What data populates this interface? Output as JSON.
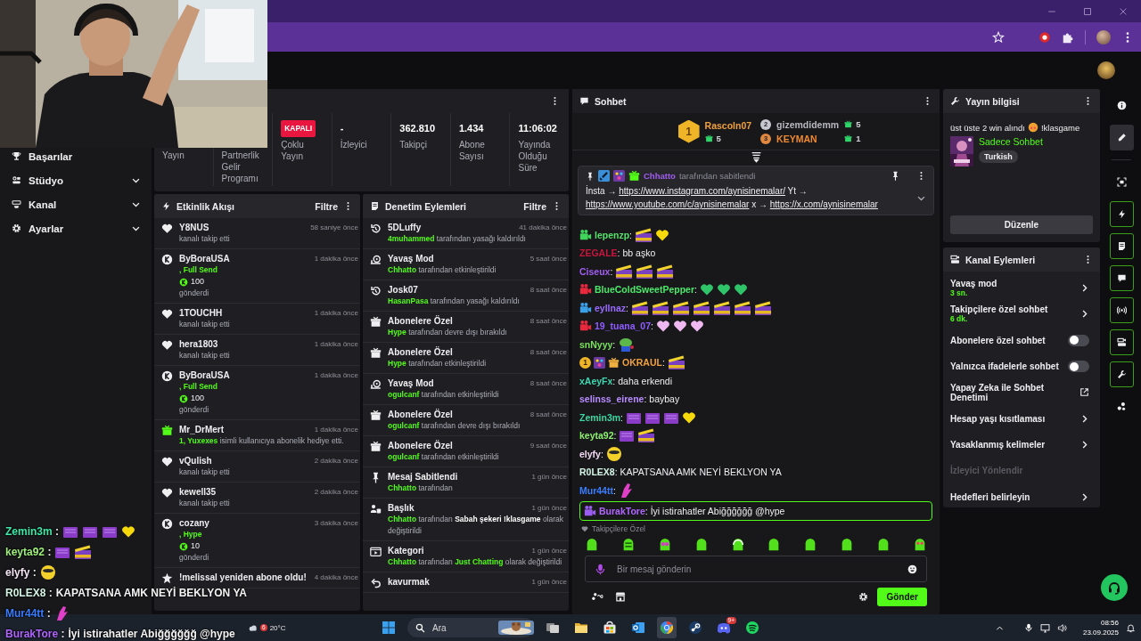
{
  "sidebar": {
    "items": [
      {
        "label": "Başarılar",
        "expandable": false
      },
      {
        "label": "Stüdyo",
        "expandable": true
      },
      {
        "label": "Kanal",
        "expandable": true
      },
      {
        "label": "Ayarlar",
        "expandable": true
      }
    ]
  },
  "stats": [
    {
      "kind": "label",
      "label": "Yayın"
    },
    {
      "kind": "label",
      "label": "Partnerlik Gelir Programı"
    },
    {
      "kind": "badge",
      "value": "KAPALI",
      "label": "Çoklu Yayın"
    },
    {
      "kind": "number",
      "value": "-",
      "label": "İzleyici"
    },
    {
      "kind": "number",
      "value": "362.810",
      "label": "Takipçi"
    },
    {
      "kind": "number",
      "value": "1.434",
      "label": "Abone Sayısı"
    },
    {
      "kind": "number",
      "value": "11:06:02",
      "label": "Yayında Olduğu Süre"
    }
  ],
  "activity_feed": {
    "title": "Etkinlik Akışı",
    "filter": "Filtre",
    "events": [
      {
        "kind": "follow",
        "user": "Y8NUS",
        "time": "58 saniye önce",
        "detail": "kanalı takip etti"
      },
      {
        "kind": "kicks",
        "user": "ByBoraUSA",
        "time": "1 dakika önce",
        "tier": ", Full Send",
        "amount": "100",
        "detail": "gönderdi"
      },
      {
        "kind": "follow",
        "user": "1TOUCHH",
        "time": "1 dakika önce",
        "detail": "kanalı takip etti"
      },
      {
        "kind": "follow",
        "user": "hera1803",
        "time": "1 dakika önce",
        "detail": "kanalı takip etti"
      },
      {
        "kind": "kicks",
        "user": "ByBoraUSA",
        "time": "1 dakika önce",
        "tier": ", Full Send",
        "amount": "100",
        "detail": "gönderdi"
      },
      {
        "kind": "gift",
        "user": "Mr_DrMert",
        "time": "1 dakika önce",
        "detail": "**1, Yuxexes** isimli kullanıcıya abonelik hediye etti."
      },
      {
        "kind": "follow",
        "user": "vQulish",
        "time": "2 dakika önce",
        "detail": "kanalı takip etti"
      },
      {
        "kind": "follow",
        "user": "kewell35",
        "time": "2 dakika önce",
        "detail": "kanalı takip etti"
      },
      {
        "kind": "kicks",
        "user": "cozany",
        "time": "3 dakika önce",
        "tier": ", Hype",
        "amount": "10",
        "detail": "gönderdi"
      },
      {
        "kind": "resub",
        "user": "!melissal yeniden abone oldu!",
        "time": "4 dakika önce"
      }
    ]
  },
  "mod_actions": {
    "title": "Denetim Eylemleri",
    "filter": "Filtre",
    "actions": [
      {
        "kind": "unban",
        "title": "5DLuffy",
        "time": "41 dakika önce",
        "detail": "**4muhammed** tarafından yasağı kaldırıldı"
      },
      {
        "kind": "slow",
        "title": "Yavaş Mod",
        "time": "5 saat önce",
        "detail": "**Chhatto** tarafından etkinleştirildi"
      },
      {
        "kind": "unban",
        "title": "Josk07",
        "time": "8 saat önce",
        "detail": "**HasanPasa** tarafından yasağı kaldırıldı"
      },
      {
        "kind": "subs",
        "title": "Abonelere Özel",
        "time": "8 saat önce",
        "detail": "**Hype** tarafından devre dışı bırakıldı"
      },
      {
        "kind": "subs",
        "title": "Abonelere Özel",
        "time": "8 saat önce",
        "detail": "**Hype** tarafından etkinleştirildi"
      },
      {
        "kind": "slow",
        "title": "Yavaş Mod",
        "time": "8 saat önce",
        "detail": "**ogulcanf** tarafından etkinleştirildi"
      },
      {
        "kind": "subs",
        "title": "Abonelere Özel",
        "time": "8 saat önce",
        "detail": "**ogulcanf** tarafından devre dışı bırakıldı"
      },
      {
        "kind": "subs",
        "title": "Abonelere Özel",
        "time": "9 saat önce",
        "detail": "**ogulcanf** tarafından etkinleştirildi"
      },
      {
        "kind": "pin",
        "title": "Mesaj Sabitlendi",
        "time": "1 gün önce",
        "detail": "**Chhatto** tarafından"
      },
      {
        "kind": "title",
        "title": "Başlık",
        "time": "1 gün önce",
        "detail": "**Chhatto** tarafından *Sabah şekeri !klasgame* olarak değiştirildi"
      },
      {
        "kind": "category",
        "title": "Kategori",
        "time": "1 gün önce",
        "detail": "**Chhatto** tarafından **Just Chatting** olarak değiştirildi"
      },
      {
        "kind": "undo",
        "title": "kavurmak",
        "time": "1 gün önce"
      }
    ]
  },
  "chat": {
    "title": "Sohbet",
    "separator": ":",
    "leaderboard": [
      {
        "rank": "1",
        "user": "Rascoln07",
        "gifts": "5"
      },
      {
        "rank": "2",
        "user": "gizemdidemm",
        "gifts": "5"
      },
      {
        "rank": "3",
        "user": "KEYMAN",
        "gifts": "1"
      }
    ],
    "pinned": {
      "badges": [
        {
          "kind": "mod"
        },
        {
          "kind": "artist"
        },
        {
          "kind": "gift",
          "color": "#53fc18"
        }
      ],
      "user": "Chhatto",
      "note": "tarafından sabitlendi",
      "content": [
        {
          "kind": "text",
          "text": "İnsta →"
        },
        {
          "kind": "link",
          "text": "https://www.instagram.com/aynisinemalar/"
        },
        {
          "kind": "text",
          "text": "Yt →"
        },
        {
          "kind": "link",
          "text": "https://www.youtube.com/c/aynisinemalar"
        },
        {
          "kind": "text",
          "text": "x →"
        },
        {
          "kind": "link",
          "text": "https://x.com/aynisinemalar"
        }
      ]
    },
    "messages": [
      {
        "user": "lepenzp",
        "color": "#57e06a",
        "highlighted": false,
        "badges": [
          {
            "kind": "camera",
            "color": "#3fd45a"
          }
        ],
        "emotes": [
          {
            "kind": "clapper"
          },
          {
            "kind": "heart",
            "color": "#f5d90a"
          }
        ]
      },
      {
        "user": "ZEGALE",
        "color": "#c8163c",
        "highlighted": false,
        "text": "bb aşko"
      },
      {
        "user": "Ciseux",
        "color": "#a25ef0",
        "highlighted": false,
        "emotes": [
          {
            "kind": "clapper"
          },
          {
            "kind": "clapper"
          },
          {
            "kind": "clapper"
          }
        ]
      },
      {
        "user": "BlueColdSweetPepper",
        "color": "#4ce86a",
        "highlighted": false,
        "badges": [
          {
            "kind": "camera",
            "color": "#e8283c"
          }
        ],
        "emotes": [
          {
            "kind": "heart",
            "color": "#2fc46a"
          },
          {
            "kind": "heart",
            "color": "#2fc46a"
          },
          {
            "kind": "heart",
            "color": "#2fc46a"
          }
        ]
      },
      {
        "user": "eyllnaz",
        "color": "#9a6bff",
        "highlighted": false,
        "badges": [
          {
            "kind": "camera",
            "color": "#3aa0e8"
          }
        ],
        "emotes": [
          {
            "kind": "clapper"
          },
          {
            "kind": "clapper"
          },
          {
            "kind": "clapper"
          },
          {
            "kind": "clapper"
          },
          {
            "kind": "clapper"
          },
          {
            "kind": "clapper"
          },
          {
            "kind": "clapper"
          }
        ]
      },
      {
        "user": "19_tuana_07",
        "color": "#8f5cff",
        "highlighted": false,
        "badges": [
          {
            "kind": "camera",
            "color": "#e8283c"
          }
        ],
        "emotes": [
          {
            "kind": "heart",
            "color": "#f0b8f0"
          },
          {
            "kind": "heart",
            "color": "#f0b8f0"
          },
          {
            "kind": "heart",
            "color": "#f0b8f0"
          }
        ]
      },
      {
        "user": "snNyyy",
        "color": "#78e05a",
        "highlighted": false,
        "emotes": [
          {
            "kind": "frog"
          }
        ]
      },
      {
        "user": "OKRAUL",
        "color": "#f0a040",
        "highlighted": false,
        "badges": [
          {
            "kind": "rank",
            "text": "1"
          },
          {
            "kind": "artist"
          },
          {
            "kind": "gift",
            "color": "#f0b040"
          }
        ],
        "emotes": [
          {
            "kind": "clapper"
          }
        ]
      },
      {
        "user": "xAeyFx",
        "color": "#3dd6b0",
        "highlighted": false,
        "text": "daha erkendi"
      },
      {
        "user": "selinss_eirene",
        "color": "#b98cff",
        "highlighted": false,
        "text": "baybay"
      },
      {
        "user": "Zemin3m",
        "color": "#3dd6a0",
        "highlighted": false,
        "emotes": [
          {
            "kind": "screen"
          },
          {
            "kind": "screen"
          },
          {
            "kind": "screen"
          },
          {
            "kind": "heart",
            "color": "#f5d90a"
          }
        ]
      },
      {
        "user": "keyta92",
        "color": "#8ef070",
        "highlighted": false,
        "emotes": [
          {
            "kind": "screen"
          },
          {
            "kind": "clapper"
          }
        ]
      },
      {
        "user": "elyfy",
        "color": "#f2d8f2",
        "highlighted": false,
        "emotes": [
          {
            "kind": "smiley"
          }
        ]
      },
      {
        "user": "R0LEX8",
        "color": "#d4f4e4",
        "highlighted": false,
        "text": "KAPATSANA AMK NEYİ BEKLYON YA"
      },
      {
        "user": "Mur44tt",
        "color": "#3b7dff",
        "highlighted": false,
        "emotes": [
          {
            "kind": "hand"
          }
        ]
      },
      {
        "user": "BurakTore",
        "color": "#b066ff",
        "highlighted": true,
        "badges": [
          {
            "kind": "camera",
            "color": "#9b5cf0"
          }
        ],
        "text": "İyi istirahatler Abiğğğğğğ @hype"
      }
    ],
    "emote_bar": {
      "label": "Takipçilere Özel",
      "emotes": [
        {
          "kind": "blob"
        },
        {
          "kind": "angry"
        },
        {
          "kind": "glasses"
        },
        {
          "kind": "blob"
        },
        {
          "kind": "headset"
        },
        {
          "kind": "blob"
        },
        {
          "kind": "blob"
        },
        {
          "kind": "blob"
        },
        {
          "kind": "blob"
        },
        {
          "kind": "hearts"
        }
      ]
    },
    "input": {
      "placeholder": "Bir mesaj gönderin"
    },
    "send": "Gönder"
  },
  "stream_info": {
    "heading": "Yayın bilgisi",
    "title_before": "üst üste 2 win alındı",
    "title_after": "!klasgame",
    "category": "Sadece Sohbet",
    "tag": "Turkish",
    "edit": "Düzenle"
  },
  "channel_actions": {
    "heading": "Kanal Eylemleri",
    "items": [
      {
        "kind": "link",
        "label": "Yavaş mod",
        "value": "3 sn.",
        "disabled": false
      },
      {
        "kind": "link",
        "label": "Takipçilere özel sohbet",
        "value": "6 dk.",
        "disabled": false
      },
      {
        "kind": "toggle",
        "label": "Abonelere özel sohbet",
        "on": false,
        "disabled": false
      },
      {
        "kind": "toggle",
        "label": "Yalnızca ifadelerle sohbet",
        "on": false,
        "disabled": false
      },
      {
        "kind": "external",
        "label": "Yapay Zeka ile Sohbet Denetimi",
        "disabled": false
      },
      {
        "kind": "link",
        "label": "Hesap yaşı kısıtlaması",
        "disabled": false
      },
      {
        "kind": "link",
        "label": "Yasaklanmış kelimeler",
        "disabled": false
      },
      {
        "kind": "plain",
        "label": "İzleyici Yönlendir",
        "disabled": true
      },
      {
        "kind": "link",
        "label": "Hedefleri belirleyin",
        "disabled": false
      }
    ]
  },
  "rail": {
    "items": [
      {
        "kind": "info",
        "selected": false,
        "active": false
      },
      {
        "kind": "edit",
        "selected": true,
        "active": false
      },
      {
        "kind": "focus",
        "selected": false,
        "active": false
      },
      {
        "kind": "bolt",
        "selected": false,
        "active": true
      },
      {
        "kind": "notes",
        "selected": false,
        "active": true
      },
      {
        "kind": "chat",
        "selected": false,
        "active": true
      },
      {
        "kind": "broadcast",
        "selected": false,
        "active": true
      },
      {
        "kind": "stream",
        "selected": false,
        "active": true
      },
      {
        "kind": "wrench",
        "selected": false,
        "active": true
      },
      {
        "kind": "dots",
        "selected": false,
        "active": false
      }
    ]
  },
  "overlay_chat": {
    "separator": " :",
    "messages": [
      {
        "user": "Zemin3m",
        "color": "#3ee8a8",
        "emotes": [
          {
            "kind": "screen"
          },
          {
            "kind": "screen"
          },
          {
            "kind": "screen"
          },
          {
            "kind": "heart",
            "color": "#f5d90a"
          }
        ]
      },
      {
        "user": "keyta92",
        "color": "#9ef07a",
        "emotes": [
          {
            "kind": "screen"
          },
          {
            "kind": "clapper"
          }
        ]
      },
      {
        "user": "elyfy",
        "color": "#f4e6f4",
        "emotes": [
          {
            "kind": "smiley"
          }
        ]
      },
      {
        "user": "R0LEX8",
        "color": "#d4f4e4",
        "text": "KAPATSANA AMK NEYİ BEKLYON YA"
      },
      {
        "user": "Mur44tt",
        "color": "#3b7dff",
        "emotes": [
          {
            "kind": "hand"
          }
        ]
      },
      {
        "user": "BurakTore",
        "color": "#b066ff",
        "text": "İyi istirahatler Abiğğğğğğ @hype"
      }
    ]
  },
  "taskbar": {
    "weather": "20°C",
    "weather_badge": "6",
    "search_placeholder": "Ara",
    "discord_badge": "9+",
    "time": "08:56",
    "date": "23.09.2025"
  }
}
